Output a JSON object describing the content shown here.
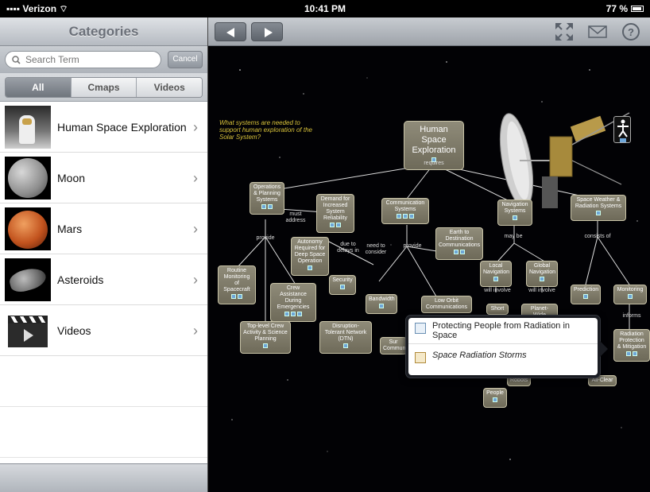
{
  "status_bar": {
    "carrier": "Verizon",
    "time": "10:41 PM",
    "battery": "77 %"
  },
  "left_panel": {
    "title": "Categories",
    "search": {
      "placeholder": "Search Term",
      "cancel_label": "Cancel"
    },
    "segments": [
      {
        "label": "All",
        "active": true
      },
      {
        "label": "Cmaps",
        "active": false
      },
      {
        "label": "Videos",
        "active": false
      }
    ],
    "items": [
      {
        "label": "Human Space Exploration",
        "icon": "astronaut-thumbnail"
      },
      {
        "label": "Moon",
        "icon": "moon-thumbnail"
      },
      {
        "label": "Mars",
        "icon": "mars-thumbnail"
      },
      {
        "label": "Asteroids",
        "icon": "asteroid-thumbnail"
      },
      {
        "label": "Videos",
        "icon": "clapperboard-icon"
      }
    ]
  },
  "toolbar": {
    "back_icon": "back-arrow-icon",
    "forward_icon": "forward-arrow-icon",
    "fullscreen_icon": "fullscreen-icon",
    "mail_icon": "mail-icon",
    "help_icon": "help-icon"
  },
  "cmap": {
    "question": "What systems are needed to support human exploration of the Solar System?",
    "nodes": {
      "root": "Human Space Exploration",
      "ops": "Operations & Planning Systems",
      "demand": "Demand for Increased System Reliability",
      "comm": "Communication Systems",
      "nav": "Navigation Systems",
      "weather": "Space Weather & Radiation Systems",
      "autonomy": "Autonomy Required for Deep Space Operation",
      "e2d": "Earth to Destination Communications",
      "local": "Local Navigation",
      "global": "Global Navigation",
      "routine": "Routine Monitoring of Spacecraft",
      "crew": "Crew Assistance During Emergencies",
      "security": "Security",
      "bandwidth": "Bandwidth",
      "leo": "Low Orbit Communications",
      "toplevel": "Top-level Crew Activity & Science Planning",
      "dtn": "Disruption-Tolerant Network (DTN)",
      "prediction": "Prediction",
      "monitoring": "Monitoring",
      "short": "Short",
      "planetwide": "Planet-Wide",
      "radiation": "Radiation Protection & Mitigation",
      "allclear": "All-Clear",
      "people": "People",
      "robots": "Robots",
      "sur": "Sur",
      "commun": "Commun"
    },
    "links": {
      "requires": "requires",
      "must_address": "must address",
      "provide": "provide",
      "due_to": "due to delays in",
      "need_to": "need to consider",
      "provide2": "provide",
      "may_be": "may be",
      "consists_of": "consists of",
      "will_involve1": "will involve",
      "will_involve2": "will involve",
      "informs": "informs"
    }
  },
  "popover": {
    "items": [
      {
        "label": "Protecting People from Radiation in Space",
        "italic": false,
        "icon": "cmap-icon"
      },
      {
        "label": "Space Radiation Storms",
        "italic": true,
        "icon": "document-icon"
      }
    ]
  }
}
